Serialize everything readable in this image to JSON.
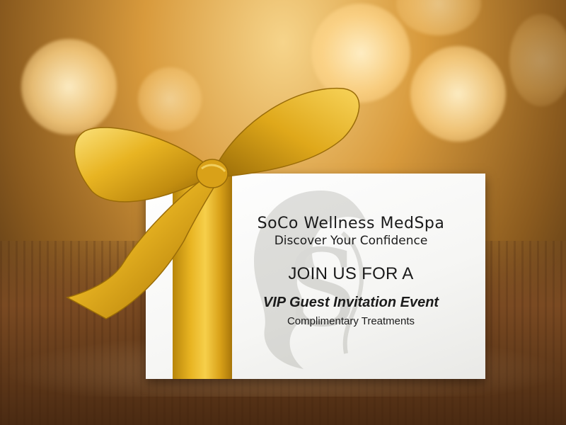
{
  "card": {
    "brand_name": "SoCo Wellness MedSpa",
    "tagline": "Discover Your Confidence",
    "headline": "JOIN US FOR A",
    "event_title": "VIP Guest Invitation Event",
    "event_subtitle": "Complimentary Treatments"
  },
  "colors": {
    "ribbon": "#e8b422",
    "ribbon_shadow": "#a8760a",
    "background_glow": "#f6d48a",
    "card": "#ffffff",
    "text": "#1b1b1b"
  },
  "icons": {
    "watermark": "soco-face-monogram-logo",
    "decoration": "gold-ribbon-bow"
  }
}
